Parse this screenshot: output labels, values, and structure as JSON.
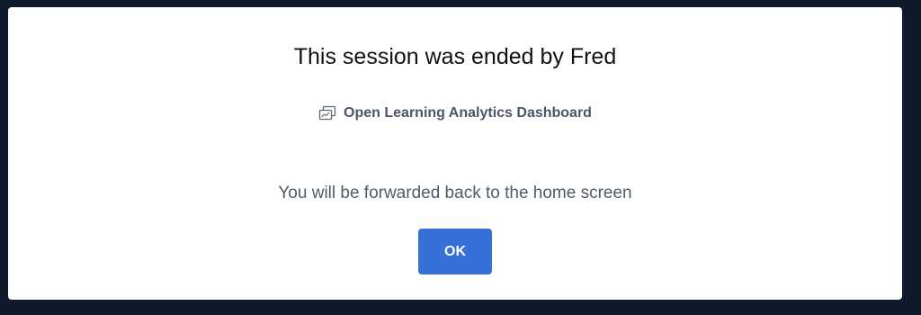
{
  "dialog": {
    "title": "This session was ended by Fred",
    "dashboard": {
      "icon": "dashboard-windows-icon",
      "label": "Open Learning Analytics Dashboard"
    },
    "message": "You will be forwarded back to the home screen",
    "ok_label": "OK"
  },
  "colors": {
    "backdrop": "#0f1a2c",
    "dialog_background": "#ffffff",
    "primary_button": "#3571d6",
    "muted_text": "#4f5a6a"
  }
}
